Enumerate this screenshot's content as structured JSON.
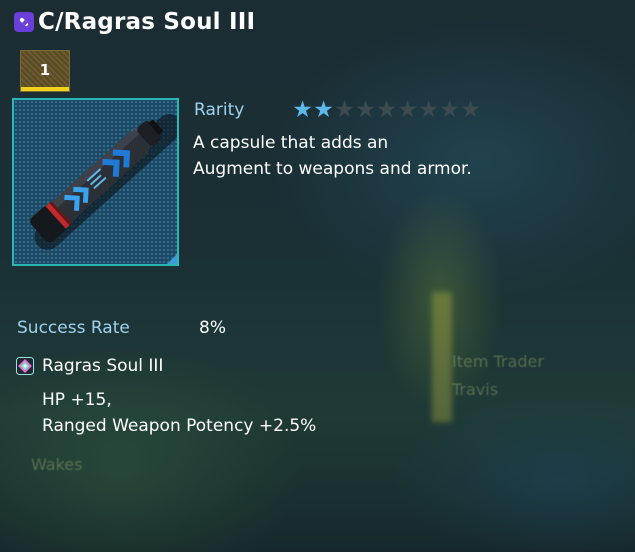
{
  "item": {
    "name": "C/Ragras Soul III",
    "count": "1",
    "icon": "capsule-item-icon"
  },
  "rarity": {
    "label": "Rarity",
    "stars_filled": 2,
    "stars_total": 9,
    "filled_color": "#5db8ea",
    "empty_color": "#3d4a50"
  },
  "description": {
    "line1": "A capsule that adds an",
    "line2": "Augment to weapons and armor."
  },
  "success": {
    "label": "Success Rate",
    "value": "8%"
  },
  "augment": {
    "name": "Ragras Soul III",
    "effect1": "HP +15,",
    "effect2": "Ranged Weapon Potency +2.5%"
  },
  "background_text": {
    "npc_name": "Item Trader",
    "npc_sub": "Travis",
    "wakes": "Wakes"
  },
  "colors": {
    "accent": "#2ab7b8",
    "label": "#9fd2ee",
    "count_bar": "#f2d21a",
    "title_icon": "#6a3ed8"
  }
}
